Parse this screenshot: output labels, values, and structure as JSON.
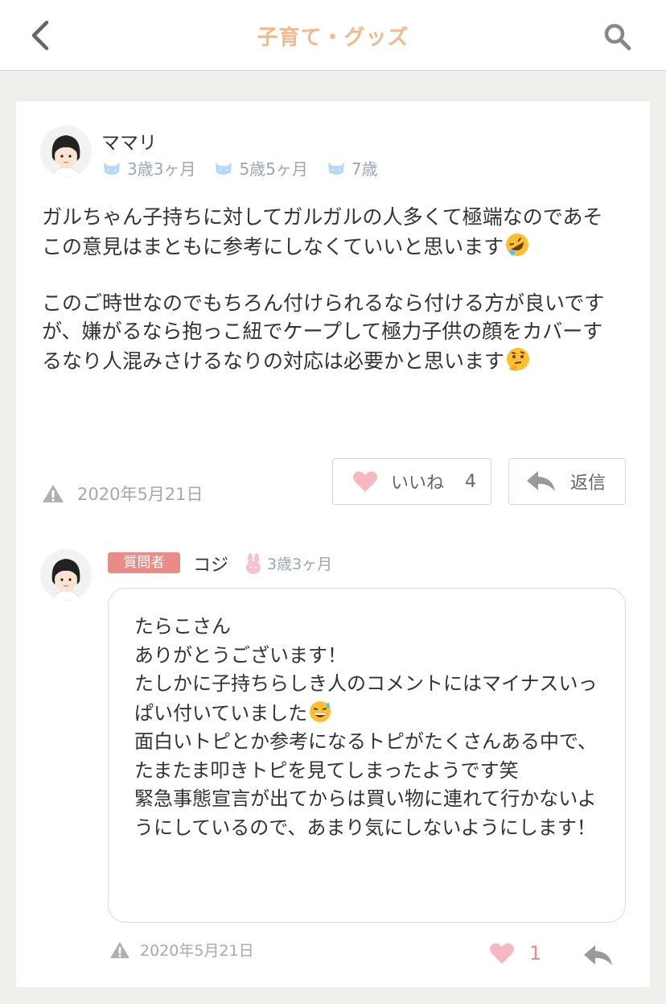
{
  "header": {
    "title": "子育て・グッズ"
  },
  "post": {
    "username": "ママリ",
    "kids": [
      "3歳3ヶ月",
      "5歳5ヶ月",
      "7歳"
    ],
    "body": [
      "ガルちゃん子持ちに対してガルガルの人多くて極端なのであそこの意見はまともに参考にしなくていいと思います",
      "",
      "このご時世なのでもちろん付けられるなら付ける方が良いですが、嫌がるなら抱っこ紐でケープして極力子供の顔をカバーするなり人混みさけるなりの対応は必要かと思います"
    ],
    "date": "2020年5月21日",
    "like_label": "いいね",
    "like_count": "4",
    "reply_label": "返信"
  },
  "reply": {
    "badge": "質問者",
    "username": "コジ",
    "kid": "3歳3ヶ月",
    "lines": [
      "たらこさん",
      "ありがとうございます！",
      "たしかに子持ちらしき人のコメントにはマイナスいっぱい付いていました",
      "面白いトピとか参考になるトピがたくさんある中で、たまたま叩きトピを見てしまったようです笑",
      "緊急事態宣言が出てからは買い物に連れて行かないようにしているので、あまり気にしないようにします！"
    ],
    "date": "2020年5月21日",
    "like_count": "1"
  },
  "colors": {
    "accent": "#f3b98d",
    "badge": "#ea8b85",
    "heart": "#f6b8c0",
    "kid_icon_blue": "#b9d6f2",
    "kid_icon_pink": "#f6c3cc"
  },
  "icons": [
    "chevron-left-icon",
    "search-icon",
    "kid-cat-icon",
    "kid-bunny-icon",
    "warning-icon",
    "heart-icon",
    "reply-arrow-icon",
    "rofl-emoji",
    "thinking-emoji",
    "sweat-smile-emoji"
  ]
}
